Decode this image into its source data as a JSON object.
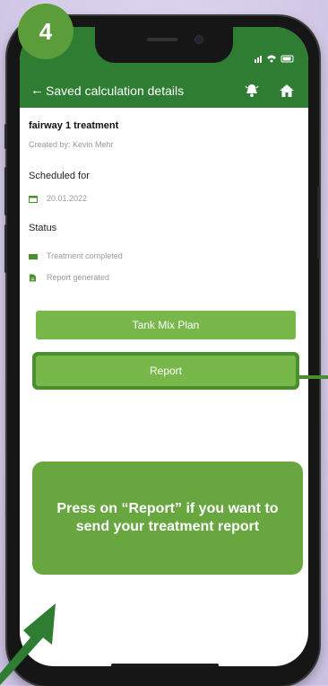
{
  "step": {
    "number": "4"
  },
  "header": {
    "title": "Saved calculation details",
    "back_icon": "arrow-left-icon",
    "bell_icon": "bell-icon",
    "home_icon": "home-icon"
  },
  "details": {
    "name": "fairway 1 treatment",
    "created_by": "Created by: Kevin Mehr",
    "scheduled_label": "Scheduled for",
    "date": "20.01.2022",
    "status_label": "Status",
    "statuses": [
      {
        "label": "Treatment completed",
        "icon": "truck-icon"
      },
      {
        "label": "Report generated",
        "icon": "document-icon"
      }
    ]
  },
  "actions": {
    "tank_mix": "Tank Mix Plan",
    "report": "Report"
  },
  "callout": {
    "text": "Press on “Report” if you want to send your treatment report"
  },
  "colors": {
    "app_green": "#2e7d32",
    "button_green": "#78b74a",
    "callout_green": "#68a640",
    "background": "#d9d1ec"
  }
}
